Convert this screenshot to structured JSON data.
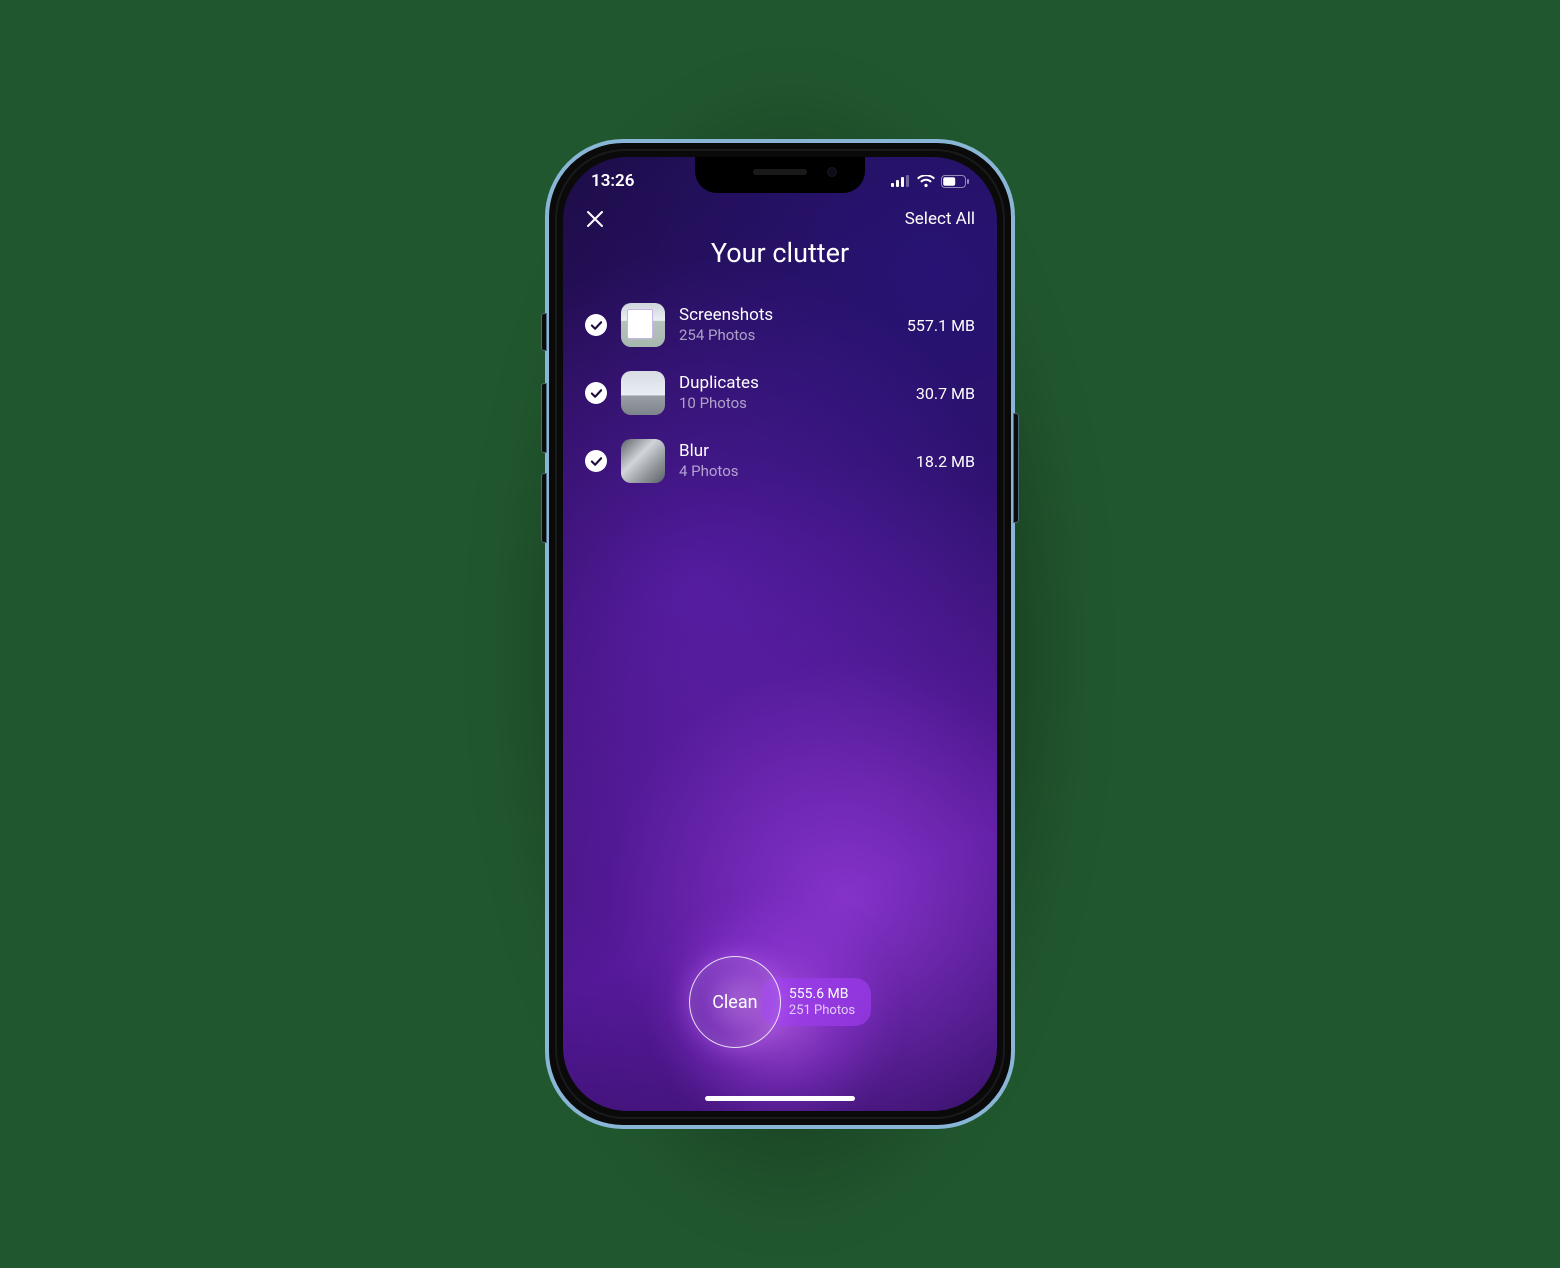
{
  "status": {
    "time": "13:26"
  },
  "nav": {
    "select_all": "Select All"
  },
  "title": "Your clutter",
  "rows": [
    {
      "title": "Screenshots",
      "sub": "254 Photos",
      "size": "557.1 MB"
    },
    {
      "title": "Duplicates",
      "sub": "10 Photos",
      "size": "30.7 MB"
    },
    {
      "title": "Blur",
      "sub": "4 Photos",
      "size": "18.2 MB"
    }
  ],
  "clean": {
    "label": "Clean",
    "size": "555.6 MB",
    "count": "251 Photos"
  }
}
